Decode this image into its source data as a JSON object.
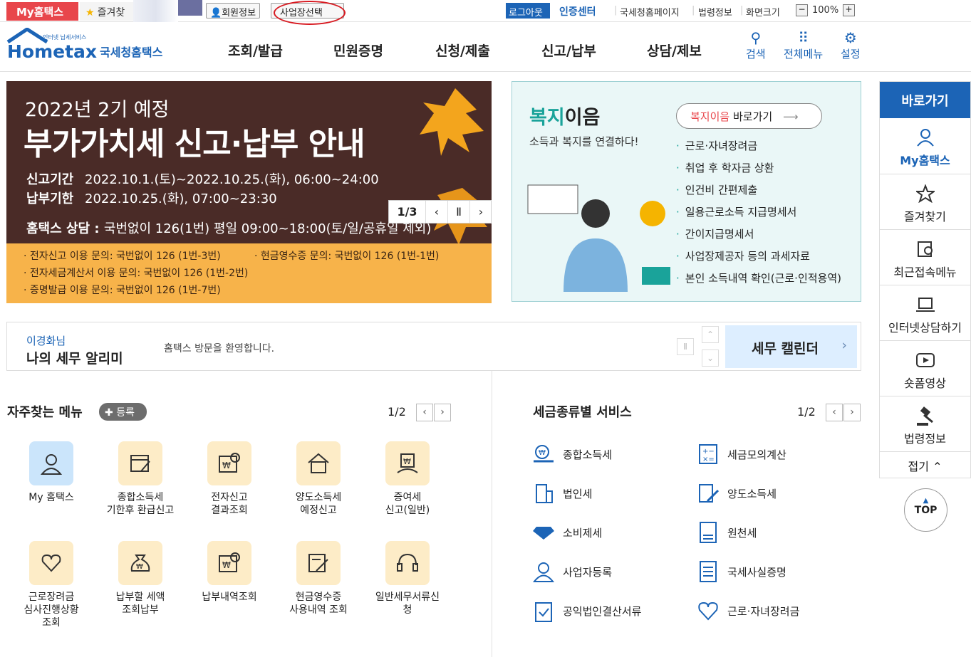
{
  "topbar": {
    "my_hometax": "My홈택스",
    "favorites": "즐겨찾",
    "member_info": "회원정보",
    "business_select": "사업장선택",
    "logout": "로그아웃",
    "cert_center": "인증센터",
    "nts_home": "국세청홈페이지",
    "law_info": "법령정보",
    "screen_size": "화면크기",
    "zoom": "100%"
  },
  "header": {
    "logo_small": "인터넷 납세서비스",
    "logo_main": "Hometax",
    "logo_kr": "국세청홈택스",
    "nav": [
      "조회/발급",
      "민원증명",
      "신청/제출",
      "신고/납부",
      "상담/제보"
    ],
    "search": "검색",
    "all_menu": "전체메뉴",
    "settings": "설정"
  },
  "banner": {
    "subtitle": "2022년 2기 예정",
    "title": "부가가치세 신고·납부 안내",
    "report_label": "신고기간",
    "report_value": "2022.10.1.(토)~2022.10.25.(화), 06:00~24:00",
    "pay_label": "납부기한",
    "pay_value": "2022.10.25.(화), 07:00~23:30",
    "call_label": "홈택스 상담 :",
    "call_value": "국번없이 126(1번)  평일 09:00~18:00(토/일/공휴일 제외)",
    "notes": [
      "· 전자신고 이용 문의: 국번없이 126 (1번-3번)",
      "· 현금영수증 문의: 국번없이 126 (1번-1번)",
      "· 전자세금계산서 이용 문의: 국번없이 126 (1번-2번)",
      "· 증명발급 이용 문의: 국번없이 126 (1번-7번)"
    ],
    "page": "1/3"
  },
  "welfare": {
    "title_a": "복지",
    "title_b": "이음",
    "subtitle": "소득과 복지를 연결하다!",
    "link_a": "복지이음",
    "link_b": " 바로가기",
    "items": [
      "근로·자녀장려금",
      "취업 후 학자금 상환",
      "인건비 간편제출",
      "일용근로소득 지급명세서",
      "간이지급명세서",
      "사업장제공자 등의 과세자료",
      "본인 소득내역 확인(근로·인적용역)"
    ]
  },
  "alert": {
    "name": "이경화님",
    "title": "나의 세무 알리미",
    "message": "홈택스 방문을 환영합니다.",
    "calendar": "세무 캘린더"
  },
  "favorites": {
    "title": "자주찾는 메뉴",
    "register": "등록",
    "page": "1/2",
    "items": [
      {
        "label": "My 홈택스"
      },
      {
        "label": "종합소득세\n기한후 환급신고"
      },
      {
        "label": "전자신고\n결과조회"
      },
      {
        "label": "양도소득세\n예정신고"
      },
      {
        "label": "증여세\n신고(일반)"
      },
      {
        "label": "근로장려금\n심사진행상황\n조회"
      },
      {
        "label": "납부할 세액\n조회납부"
      },
      {
        "label": "납부내역조회"
      },
      {
        "label": "현금영수증\n사용내역 조회"
      },
      {
        "label": "일반세무서류신청"
      }
    ]
  },
  "tax_services": {
    "title": "세금종류별 서비스",
    "page": "1/2",
    "left": [
      "종합소득세",
      "법인세",
      "소비제세",
      "사업자등록",
      "공익법인결산서류"
    ],
    "right": [
      "세금모의계산",
      "양도소득세",
      "원천세",
      "국세사실증명",
      "근로·자녀장려금"
    ]
  },
  "quick": {
    "title": "바로가기",
    "items": [
      "My홈택스",
      "즐겨찾기",
      "최근접속메뉴",
      "인터넷상담하기",
      "숏폼영상",
      "법령정보"
    ],
    "fold": "접기",
    "top": "TOP"
  },
  "colors": {
    "primary": "#1c64b6",
    "accent": "#e8464b",
    "banner_bg": "#4a2b27",
    "banner_bottom": "#f7b34a",
    "welfare_bg": "#eaf7f7"
  }
}
